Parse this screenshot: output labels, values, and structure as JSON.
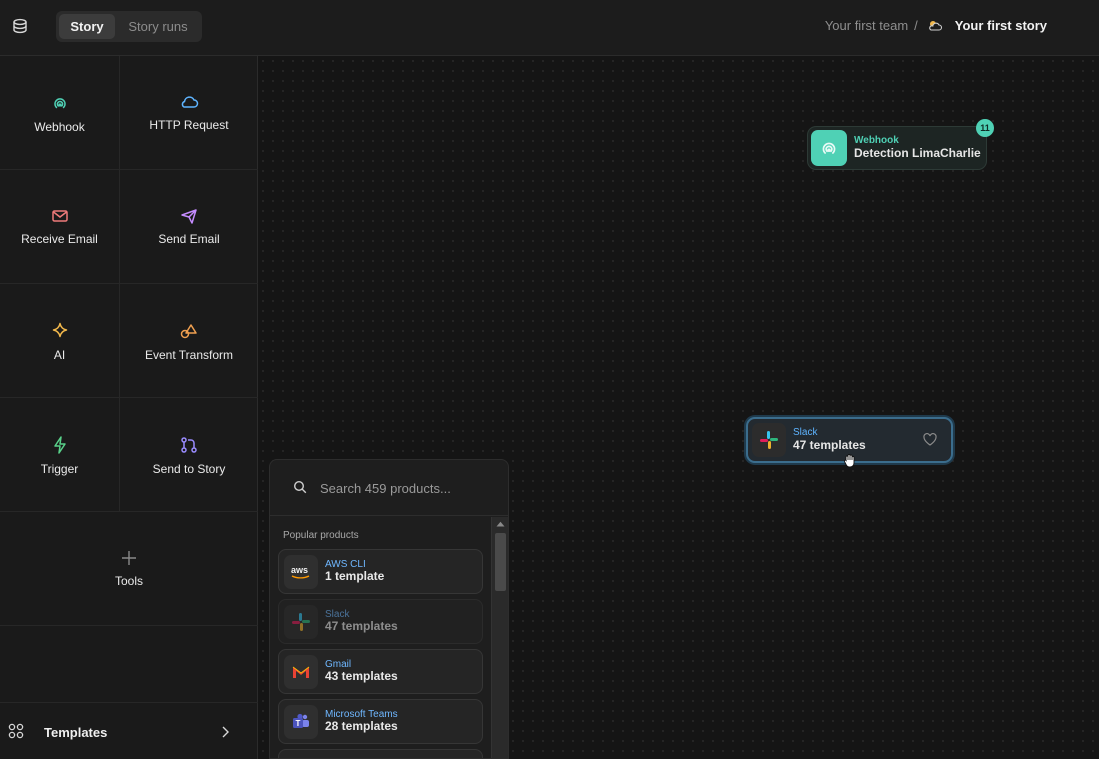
{
  "header": {
    "tabs": [
      {
        "label": "Story",
        "active": true
      },
      {
        "label": "Story runs",
        "active": false
      }
    ],
    "breadcrumb": {
      "team": "Your first team",
      "separator": "/",
      "story": "Your first story"
    }
  },
  "sidebar": {
    "actions": [
      {
        "label": "Webhook",
        "icon": "webhook-icon",
        "color": "#4fd1b5"
      },
      {
        "label": "HTTP Request",
        "icon": "cloud-icon",
        "color": "#5eb4ff"
      },
      {
        "label": "Receive Email",
        "icon": "mail-icon",
        "color": "#f07b7b"
      },
      {
        "label": "Send Email",
        "icon": "send-icon",
        "color": "#c58cff"
      },
      {
        "label": "AI",
        "icon": "sparkle-icon",
        "color": "#f2b84b"
      },
      {
        "label": "Event Transform",
        "icon": "shapes-icon",
        "color": "#f0a050"
      },
      {
        "label": "Trigger",
        "icon": "bolt-icon",
        "color": "#59d28a"
      },
      {
        "label": "Send to Story",
        "icon": "branch-icon",
        "color": "#9a8cff"
      },
      {
        "label": "Tools",
        "icon": "plus-icon",
        "color": "#8a8a8a"
      }
    ],
    "templates_label": "Templates"
  },
  "canvas": {
    "webhook_node": {
      "kind": "Webhook",
      "name": "Detection LimaCharlie",
      "badge": "11",
      "accent": "#4fd1b5"
    },
    "slack_node": {
      "kind": "Slack",
      "name": "47 templates",
      "accent": "#5eb4ff"
    }
  },
  "product_panel": {
    "search_placeholder": "Search 459 products...",
    "section_label": "Popular products",
    "products": [
      {
        "name": "AWS CLI",
        "count": "1 template",
        "logo": "aws-logo"
      },
      {
        "name": "Slack",
        "count": "47 templates",
        "logo": "slack-logo"
      },
      {
        "name": "Gmail",
        "count": "43 templates",
        "logo": "gmail-logo"
      },
      {
        "name": "Microsoft Teams",
        "count": "28 templates",
        "logo": "teams-logo"
      }
    ]
  }
}
